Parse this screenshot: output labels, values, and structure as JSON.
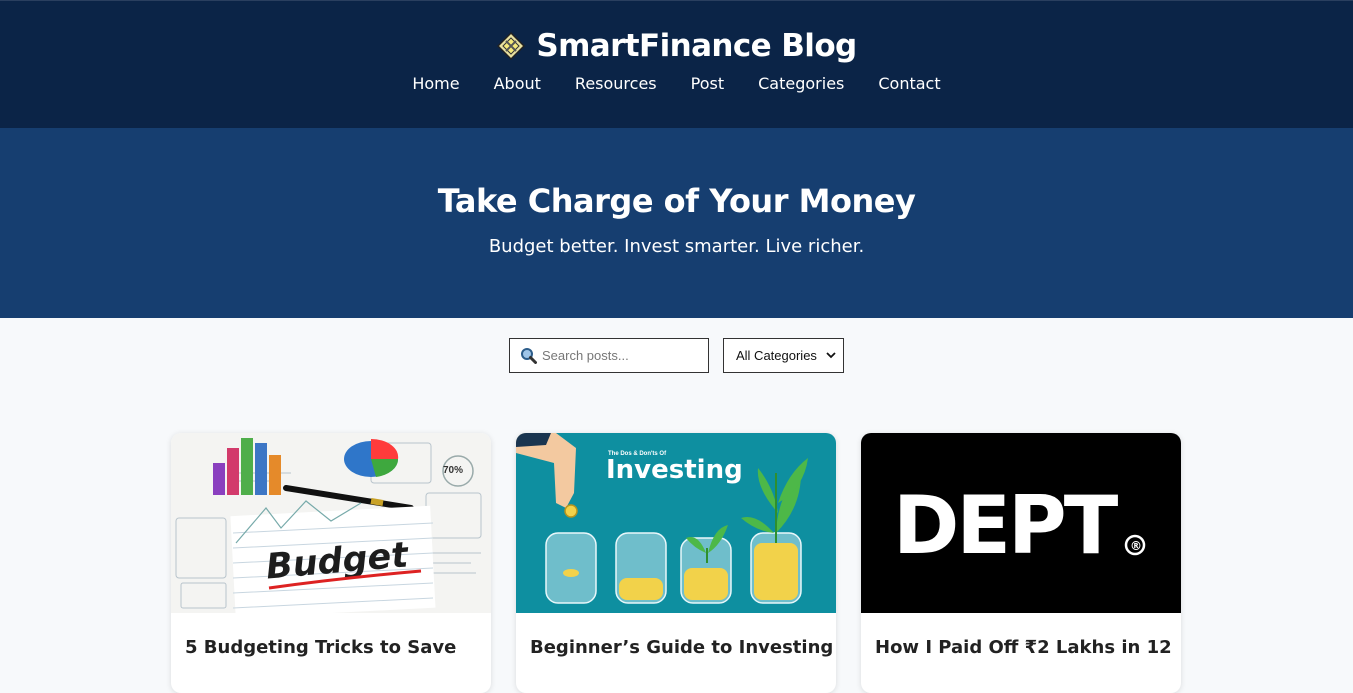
{
  "site": {
    "title": "SmartFinance Blog",
    "nav": [
      "Home",
      "About",
      "Resources",
      "Post",
      "Categories",
      "Contact"
    ]
  },
  "hero": {
    "heading": "Take Charge of Your Money",
    "subheading": "Budget better. Invest smarter. Live richer."
  },
  "filters": {
    "search_placeholder": "Search posts...",
    "category_selected": "All Categories"
  },
  "posts": [
    {
      "title": "5 Budgeting Tricks to Save",
      "image_text": "Budget",
      "image_badge": "70%"
    },
    {
      "title": "Beginner’s Guide to Investing",
      "image_text": "Investing",
      "image_caption": "The Dos & Don'ts Of"
    },
    {
      "title": "How I Paid Off ₹2 Lakhs in 12",
      "image_text": "DEPT",
      "image_mark": "®"
    }
  ],
  "colors": {
    "header_bg": "#0b2447",
    "hero_bg": "#163e70",
    "page_bg": "#f7f9fb",
    "investing_bg": "#0e8fa0"
  }
}
